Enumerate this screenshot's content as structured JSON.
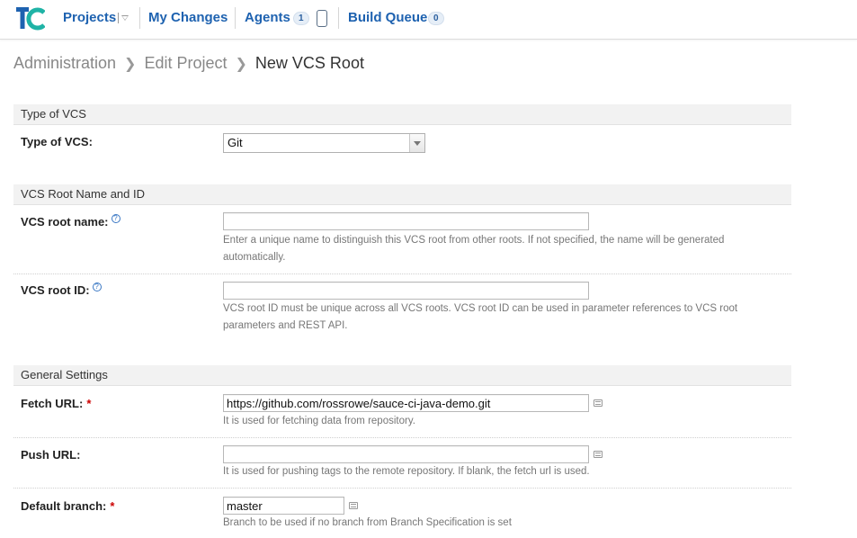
{
  "nav": {
    "projects_label": "Projects",
    "my_changes_label": "My Changes",
    "agents_label": "Agents",
    "agents_count": "1",
    "build_queue_label": "Build Queue",
    "build_queue_count": "0",
    "brand_colors": {
      "teal": "#1fb3a6",
      "blue": "#1e62b0"
    }
  },
  "breadcrumb": {
    "items": [
      "Administration",
      "Edit Project"
    ],
    "current": "New VCS Root"
  },
  "form": {
    "section_type": {
      "header": "Type of VCS",
      "label": "Type of VCS:",
      "selected": "Git"
    },
    "section_name": {
      "header": "VCS Root Name and ID",
      "name_label": "VCS root name:",
      "name_value": "",
      "name_hint": "Enter a unique name to distinguish this VCS root from other roots. If not specified, the name will be generated automatically.",
      "id_label": "VCS root ID:",
      "id_value": "",
      "id_hint": "VCS root ID must be unique across all VCS roots. VCS root ID can be used in parameter references to VCS root parameters and REST API."
    },
    "section_general": {
      "header": "General Settings",
      "fetch_label": "Fetch URL:",
      "fetch_value": "https://github.com/rossrowe/sauce-ci-java-demo.git",
      "fetch_hint": "It is used for fetching data from repository.",
      "push_label": "Push URL:",
      "push_value": "",
      "push_hint": "It is used for pushing tags to the remote repository. If blank, the fetch url is used.",
      "branch_label": "Default branch:",
      "branch_value": "master",
      "branch_hint": "Branch to be used if no branch from Branch Specification is set"
    },
    "required_mark": "*",
    "help_glyph": "?"
  }
}
